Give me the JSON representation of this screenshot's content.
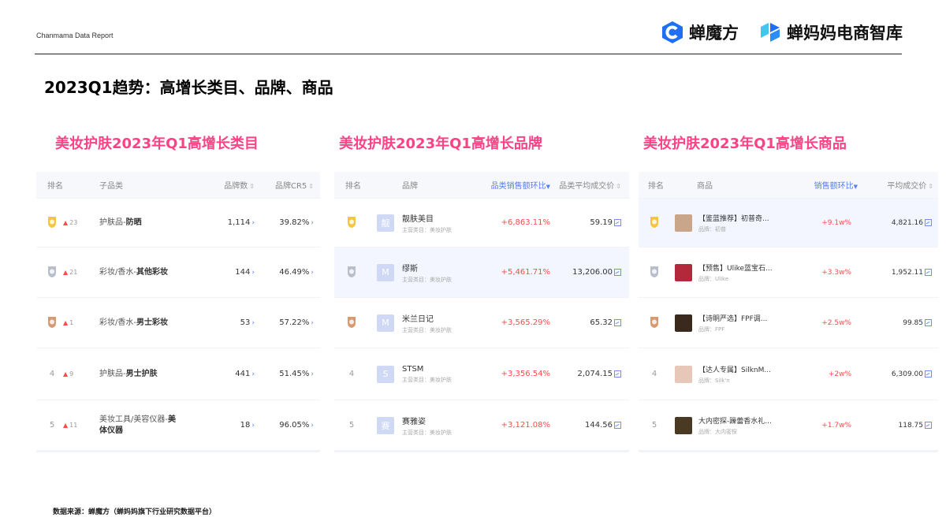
{
  "header": {
    "report_label": "Chanmama Data Report",
    "brand1": "蝉魔方",
    "brand2": "蝉妈妈电商智库"
  },
  "page_title": "2023Q1趋势：高增长类目、品牌、商品",
  "categories": {
    "title": "美妆护肤2023年Q1高增长类目",
    "headers": [
      "排名",
      "子品类",
      "品牌数",
      "品牌CR5"
    ],
    "rows": [
      {
        "rank": "",
        "change": "23",
        "cat_prefix": "护肤品-",
        "cat_bold": "防晒",
        "brands": "1,114",
        "cr5": "39.82%"
      },
      {
        "rank": "",
        "change": "21",
        "cat_prefix": "彩妆/香水-",
        "cat_bold": "其他彩妆",
        "brands": "144",
        "cr5": "46.49%"
      },
      {
        "rank": "",
        "change": "1",
        "cat_prefix": "彩妆/香水-",
        "cat_bold": "男士彩妆",
        "brands": "53",
        "cr5": "57.22%"
      },
      {
        "rank": "4",
        "change": "9",
        "cat_prefix": "护肤品-",
        "cat_bold": "男士护肤",
        "brands": "441",
        "cr5": "51.45%"
      },
      {
        "rank": "5",
        "change": "11",
        "cat_prefix": "美妆工具/美容仪器-",
        "cat_bold": "美体仪器",
        "brands": "18",
        "cr5": "96.05%"
      }
    ]
  },
  "brands": {
    "title": "美妆护肤2023年Q1高增长品牌",
    "headers": [
      "排名",
      "品牌",
      "品类销售额环比",
      "品类平均成交价"
    ],
    "rows": [
      {
        "rank": "",
        "logo": "靓",
        "name": "靓肤美目",
        "sub": "主营类目：美妆护肤",
        "growth": "+6,863.11%",
        "price": "59.19"
      },
      {
        "rank": "",
        "logo": "M",
        "name": "缪斯",
        "sub": "主营类目：美妆护肤",
        "growth": "+5,461.71%",
        "price": "13,206.00"
      },
      {
        "rank": "",
        "logo": "M",
        "name": "米兰日记",
        "sub": "主营类目：美妆护肤",
        "growth": "+3,565.29%",
        "price": "65.32"
      },
      {
        "rank": "4",
        "logo": "S",
        "name": "STSM",
        "sub": "主营类目：美妆护肤",
        "growth": "+3,356.54%",
        "price": "2,074.15"
      },
      {
        "rank": "5",
        "logo": "赛",
        "name": "赛雅姿",
        "sub": "主营类目：美妆护肤",
        "growth": "+3,121.08%",
        "price": "144.56"
      }
    ]
  },
  "products": {
    "title": "美妆护肤2023年Q1高增长商品",
    "headers": [
      "排名",
      "商品",
      "销售额环比",
      "平均成交价"
    ],
    "rows": [
      {
        "rank": "",
        "name": "【鉴蓝推荐】初普奇...",
        "brand": "品牌：初普",
        "growth": "+9.1w%",
        "price": "4,821.16",
        "img": "#c9a58a"
      },
      {
        "rank": "",
        "name": "【预售】Ulike蓝宝石...",
        "brand": "品牌：Ulike",
        "growth": "+3.3w%",
        "price": "1,952.11",
        "img": "#b3283a"
      },
      {
        "rank": "",
        "name": "【诗眀严选】FPF调...",
        "brand": "品牌：FPF",
        "growth": "+2.5w%",
        "price": "99.85",
        "img": "#3a2a1e"
      },
      {
        "rank": "4",
        "name": "【达人专属】SilknM...",
        "brand": "品牌：Silk'n",
        "growth": "+2w%",
        "price": "6,309.00",
        "img": "#e7c7b8"
      },
      {
        "rank": "5",
        "name": "大内密探-躁蕾香水礼...",
        "brand": "品牌：大内密探",
        "growth": "+1.7w%",
        "price": "118.75",
        "img": "#4a3a24"
      }
    ]
  },
  "footer": {
    "source": "数据来源：蝉魔方（蝉妈妈旗下行业研究数据平台）"
  },
  "colors": {
    "accent_pink": "#ff4185",
    "blue": "#5a7df6",
    "gold": "#f5c542",
    "silver": "#b9bfca",
    "bronze": "#d69a72"
  }
}
